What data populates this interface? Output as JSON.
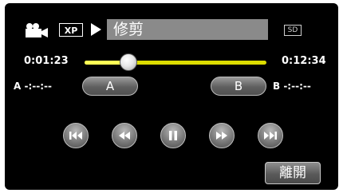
{
  "header": {
    "mode_icon": "video-camera-icon",
    "quality_badge": "XP",
    "play_state_icon": "play-icon",
    "title": "修剪",
    "media_badge": "SD"
  },
  "timeline": {
    "current_time": "0:01:23",
    "total_time": "0:12:34",
    "progress": 0.24,
    "colors": {
      "track": "#dcdc00",
      "fill": "#ffff55"
    }
  },
  "ab_points": {
    "a_label": "A",
    "a_readout": "A -:--:--",
    "b_label": "B",
    "b_readout": "B -:--:--"
  },
  "controls": [
    {
      "name": "skip-back-button",
      "icon": "skip-back-icon"
    },
    {
      "name": "rewind-button",
      "icon": "rewind-icon"
    },
    {
      "name": "pause-button",
      "icon": "pause-icon"
    },
    {
      "name": "fast-forward-button",
      "icon": "fast-forward-icon"
    },
    {
      "name": "skip-forward-button",
      "icon": "skip-forward-icon"
    }
  ],
  "footer": {
    "close_label": "離開"
  }
}
